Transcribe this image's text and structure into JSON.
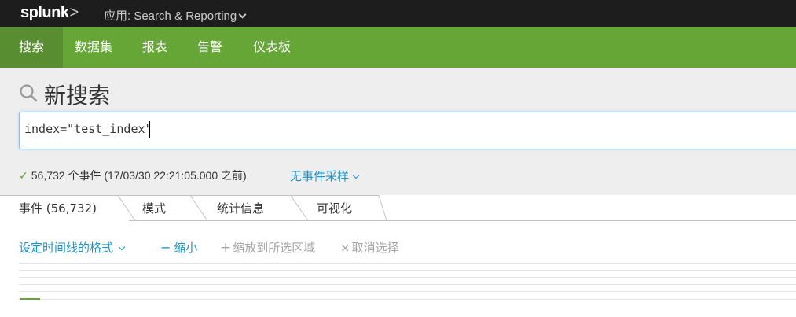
{
  "topbar": {
    "logo": "splunk",
    "logo_suffix": ">",
    "app_label": "应用: Search & Reporting"
  },
  "nav": {
    "items": [
      {
        "label": "搜索",
        "active": true
      },
      {
        "label": "数据集",
        "active": false
      },
      {
        "label": "报表",
        "active": false
      },
      {
        "label": "告警",
        "active": false
      },
      {
        "label": "仪表板",
        "active": false
      }
    ]
  },
  "search": {
    "title": "新搜索",
    "query": "index=\"test_index\""
  },
  "status": {
    "check_glyph": "✓",
    "summary": "56,732 个事件 (17/03/30 22:21:05.000 之前)",
    "sampling_label": "无事件采样"
  },
  "tabs": [
    {
      "label": "事件 (56,732)",
      "active": true
    },
    {
      "label": "模式",
      "active": false
    },
    {
      "label": "统计信息",
      "active": false
    },
    {
      "label": "可视化",
      "active": false
    }
  ],
  "timeline": {
    "format_label": "设定时间线的格式",
    "zoom_out_glyph": "−",
    "zoom_out_label": "缩小",
    "zoom_selection_glyph": "+",
    "zoom_selection_label": "缩放到所选区域",
    "deselect_glyph": "×",
    "deselect_label": "取消选择"
  },
  "colors": {
    "brand_green": "#65a637",
    "nav_active": "#588d32",
    "link_blue": "#1e93c6",
    "disabled_gray": "#a5a5a5"
  }
}
